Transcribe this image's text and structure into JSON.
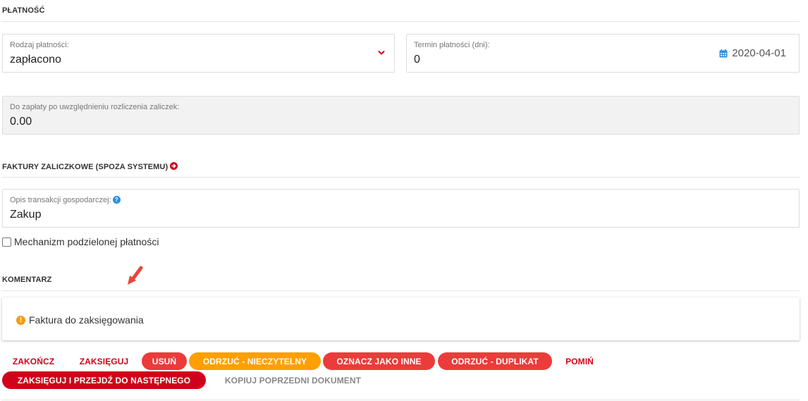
{
  "payment": {
    "section_title": "PŁATNOŚĆ",
    "method": {
      "label": "Rodzaj płatności:",
      "value": "zapłacono",
      "icon": "chevron-down-icon"
    },
    "due": {
      "label": "Termin płatności (dni):",
      "value": "0",
      "date": "2020-04-01",
      "icon": "calendar-icon"
    },
    "to_pay": {
      "label": "Do zapłaty po uwzględnieniu rozliczenia zaliczek:",
      "value": "0.00"
    }
  },
  "advance_invoices": {
    "section_title": "FAKTURY ZALICZKOWE (SPOZA SYSTEMU)",
    "icon": "arrow-circle-right-icon"
  },
  "transaction": {
    "label": "Opis transakcji gospodarczej:",
    "help_icon": "question-circle-icon",
    "value": "Zakup"
  },
  "split_payment": {
    "label": "Mechanizm podzielonej płatności",
    "checked": false
  },
  "comment": {
    "section_title": "KOMENTARZ",
    "pointer_icon": "cursor-arrow-icon",
    "text": "Faktura do zaksięgowania",
    "icon": "exclamation-circle-icon"
  },
  "actions": {
    "finish": "ZAKOŃCZ",
    "post": "ZAKSIĘGUJ",
    "delete": "USUŃ",
    "reject_unreadable": "ODRZUĆ - NIECZYTELNY",
    "mark_other": "OZNACZ JAKO INNE",
    "reject_duplicate": "ODRZUĆ - DUPLIKAT",
    "skip": "POMIŃ",
    "post_next": "ZAKSIĘGUJ I PRZEJDŹ DO NASTĘPNEGO",
    "copy_previous": "KOPIUJ POPRZEDNI DOKUMENT"
  },
  "colors": {
    "accent_red": "#d0021b",
    "button_red": "#ec3b3b",
    "button_orange": "#ff9f00",
    "info_blue": "#2a8fe0",
    "warning_orange": "#f39c12"
  }
}
